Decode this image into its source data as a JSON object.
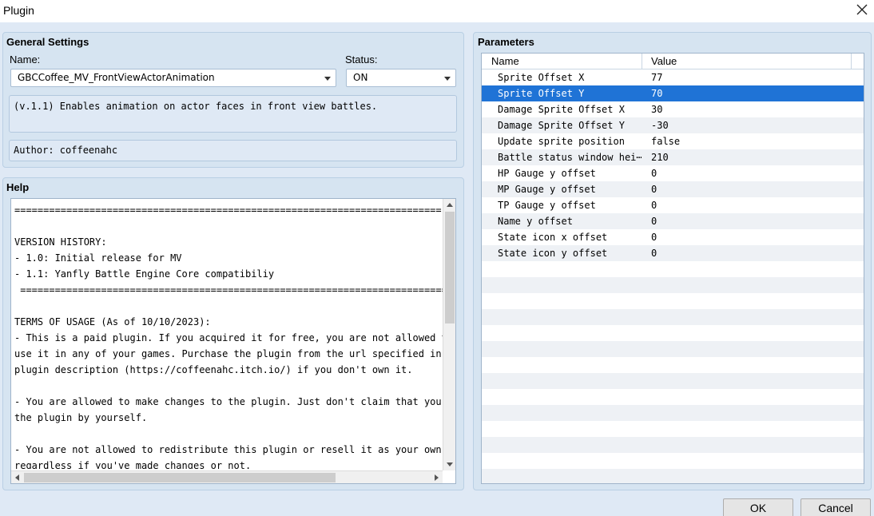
{
  "window": {
    "title": "Plugin"
  },
  "general": {
    "title": "General Settings",
    "name_label": "Name:",
    "name_value": "GBCCoffee_MV_FrontViewActorAnimation",
    "status_label": "Status:",
    "status_value": "ON",
    "description": "(v.1.1) Enables animation on actor faces in front view battles.",
    "author": "Author: coffeenahc"
  },
  "help": {
    "title": "Help",
    "text": "==========================================================================\n\nVERSION HISTORY:\n- 1.0: Initial release for MV\n- 1.1: Yanfly Battle Engine Core compatibiliy\n ==========================================================================\n\nTERMS OF USAGE (As of 10/10/2023):\n- This is a paid plugin. If you acquired it for free, you are not allowed to\nuse it in any of your games. Purchase the plugin from the url specified in the\nplugin description (https://coffeenahc.itch.io/) if you don't own it.\n\n- You are allowed to make changes to the plugin. Just don't claim that you made\nthe plugin by yourself.\n\n- You are not allowed to redistribute this plugin or resell it as your own,\nregardless if you've made changes or not."
  },
  "parameters": {
    "title": "Parameters",
    "columns": [
      "Name",
      "Value"
    ],
    "rows": [
      {
        "name": "Sprite Offset X",
        "value": "77"
      },
      {
        "name": "Sprite Offset Y",
        "value": "70"
      },
      {
        "name": "Damage Sprite Offset X",
        "value": "30"
      },
      {
        "name": "Damage Sprite Offset Y",
        "value": "-30"
      },
      {
        "name": "Update sprite position",
        "value": "false"
      },
      {
        "name": "Battle status window hei⋯",
        "value": "210"
      },
      {
        "name": "HP Gauge y offset",
        "value": "0"
      },
      {
        "name": "MP Gauge y offset",
        "value": "0"
      },
      {
        "name": "TP Gauge y offset",
        "value": "0"
      },
      {
        "name": "Name y offset",
        "value": "0"
      },
      {
        "name": "State icon x offset",
        "value": "0"
      },
      {
        "name": "State icon y offset",
        "value": "0"
      }
    ],
    "selected_index": 1
  },
  "buttons": {
    "ok": "OK",
    "cancel": "Cancel"
  },
  "colors": {
    "accent": "#1f73d6",
    "panel": "#d6e4f1",
    "background": "#dfe9f5"
  }
}
